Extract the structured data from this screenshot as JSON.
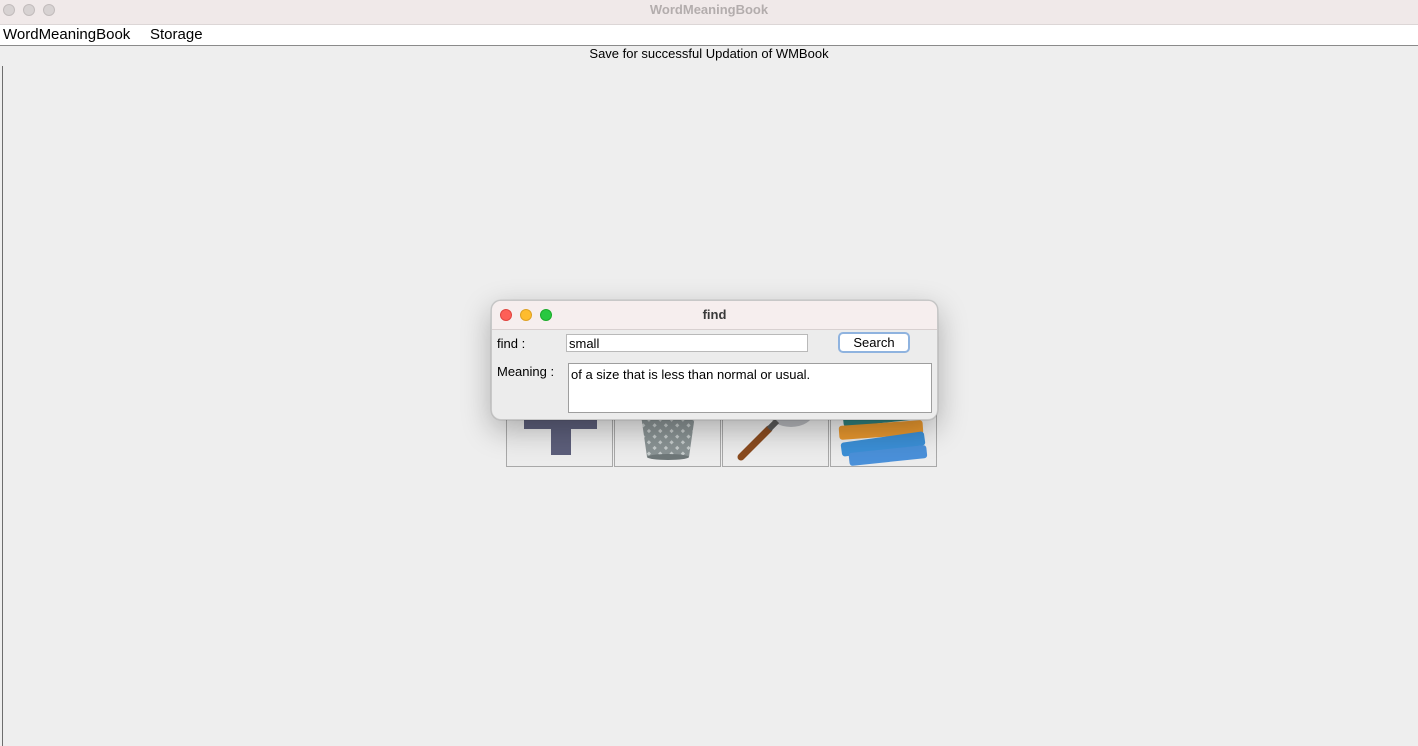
{
  "window": {
    "title": "WordMeaningBook"
  },
  "menubar": {
    "items": [
      {
        "label": "WordMeaningBook"
      },
      {
        "label": "Storage"
      }
    ]
  },
  "status": {
    "text": "Save for successful Updation of WMBook"
  },
  "toolbar": {
    "buttons": [
      {
        "icon": "plus-icon"
      },
      {
        "icon": "trash-icon"
      },
      {
        "icon": "magnifier-icon"
      },
      {
        "icon": "books-icon"
      }
    ]
  },
  "dialog": {
    "title": "find",
    "find_label": "find :",
    "find_value": "small",
    "search_label": "Search",
    "meaning_label": "Meaning :",
    "meaning_value": "of a size that is less than normal or usual."
  },
  "colors": {
    "close": "#fe5f57",
    "minimize": "#febc2e",
    "zoom": "#28c840",
    "focus_ring": "#8fb3df"
  }
}
